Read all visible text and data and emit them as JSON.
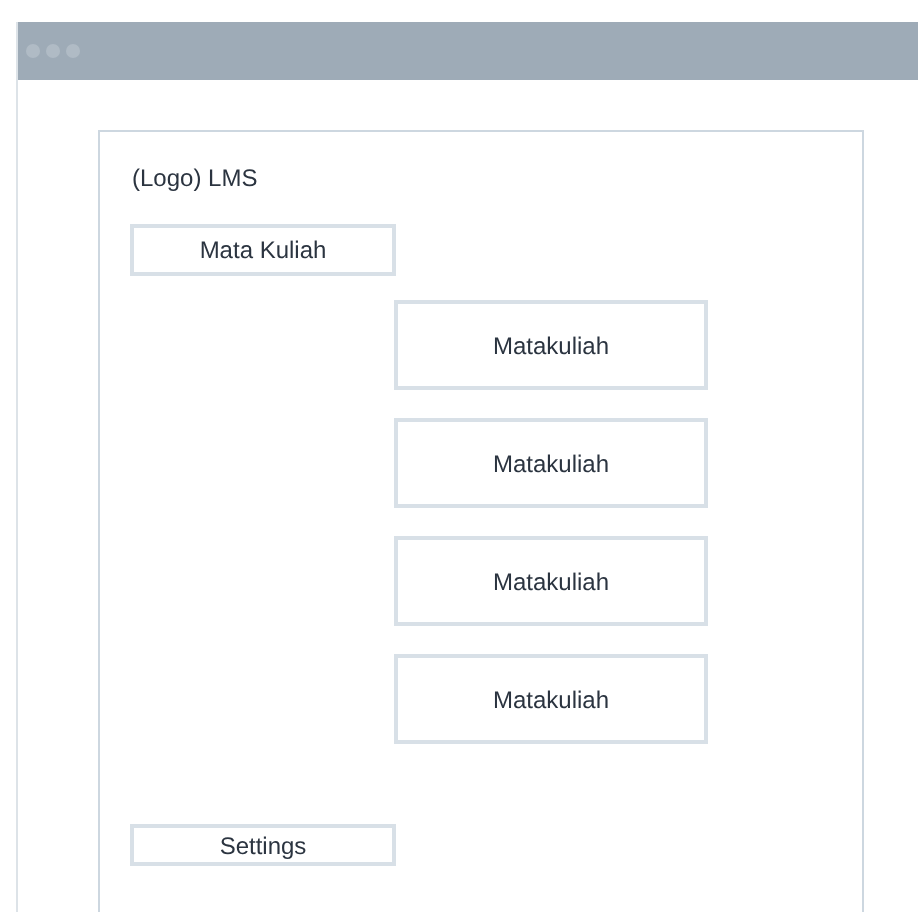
{
  "logo": "(Logo) LMS",
  "nav": [
    {
      "label": "Mata Kuliah"
    }
  ],
  "courses": [
    "Matakuliah",
    "Matakuliah",
    "Matakuliah",
    "Matakuliah"
  ],
  "footer_nav": [
    {
      "label": "Settings"
    }
  ]
}
